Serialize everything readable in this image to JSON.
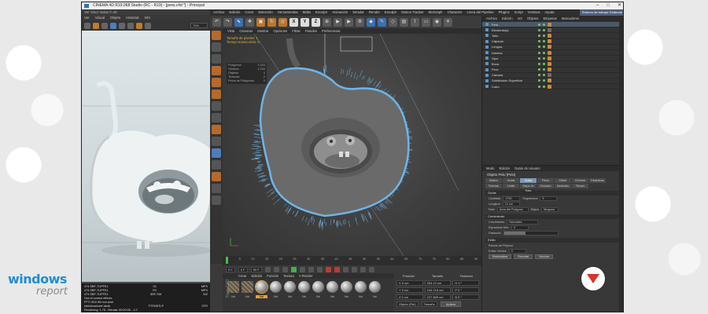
{
  "app": {
    "title": "CINEMA 4D R19.068 Studio (RC - R19) - [pera.c4d *] - Principal",
    "layout_label": "Entorno de trabajo: Estándar"
  },
  "viewer": {
    "title": "Ver Visor Variar F-40",
    "menu": [
      "Ver",
      "Visual",
      "Objeto",
      "Historial",
      "Info"
    ],
    "zoom": "70%",
    "stats": [
      {
        "k": "474 SBF-TUPFE1",
        "v": "S1",
        "v2": "MPS"
      },
      {
        "k": "474 SBF-TUPFE1",
        "v": "R1",
        "v2": "MPS"
      },
      {
        "k": "474 SBF-TUPFE1",
        "v": "SBF-SM",
        "v2": "W2"
      },
      {
        "k": "Out-of-control effects",
        "v": "",
        "v2": ""
      },
      {
        "k": "FFTI 5S2-98 rect.arsh",
        "v": "",
        "v2": ""
      },
      {
        "k": "Inbk4eas4wef-abnb",
        "v": "FTRXBTLP",
        "v2": "STR"
      },
      {
        "k": "Rendering: 1.75 - Mxrata: 00:00:06 - 1.2",
        "v": "",
        "v2": ""
      }
    ]
  },
  "menubar": [
    "Archivo",
    "Edición",
    "Crear",
    "Selección",
    "Herramientas",
    "Malla",
    "Esculpir",
    "Animación",
    "Simular",
    "Render",
    "Esculpir",
    "Motion Tracker",
    "MoGraph",
    "Character",
    "Línea del Pipeline",
    "Plugins",
    "Script",
    "Ventana",
    "Ayuda"
  ],
  "toolbar": {
    "axis_letters": [
      "X",
      "Y",
      "Z"
    ]
  },
  "viewport": {
    "menu": [
      "Vista",
      "Cámaras",
      "Mostrar",
      "Opciones",
      "Filtrar",
      "Paneles",
      "Preferencias"
    ],
    "hud_lines": [
      "Tamaño de píxeles: 1",
      "Tiempo transcurrido: 0"
    ],
    "info_rows": [
      {
        "k": "Polígonos",
        "v": "1.024"
      },
      {
        "k": "Vértices",
        "v": "1.240"
      },
      {
        "k": "Objetos",
        "v": "4"
      },
      {
        "k": "Texturas",
        "v": "2"
      },
      {
        "k": "Pelos de Polígonos",
        "v": "0"
      }
    ]
  },
  "timeline": {
    "marks": [
      "0",
      "5",
      "10",
      "15",
      "20",
      "25",
      "30",
      "35",
      "40",
      "45",
      "50",
      "55",
      "60",
      "65",
      "70",
      "75",
      "80",
      "85",
      "90"
    ],
    "frame_start": "0 F",
    "frame_end": "90 F",
    "current": "0 F"
  },
  "materials": {
    "menu": [
      "Crear",
      "Edición",
      "Función",
      "Textura",
      "A Render"
    ],
    "items": [
      "Mat",
      "Mat",
      "Mat",
      "Mat",
      "Mat",
      "Mat",
      "Mat",
      "Mat",
      "Mat",
      "Mat",
      "Mat"
    ],
    "selected_index": 2,
    "side_label": "Tipos C4D"
  },
  "coords": {
    "headers": [
      "Posición",
      "Tamaño",
      "Rotación"
    ],
    "rows": [
      [
        "X 0 cm",
        "254.12 cm",
        "H 0 °"
      ],
      [
        "Y 0 cm",
        "244.716 cm",
        "P 0 °"
      ],
      [
        "Z 0 cm",
        "227.809 cm",
        "B 0 °"
      ]
    ],
    "mode": "Objeto (Rel)",
    "size_mode": "Tamaño",
    "apply_label": "Aplicar"
  },
  "objects": {
    "menu": [
      "Archivo",
      "Edición",
      "Ver",
      "Objetos",
      "Etiquetas",
      "Marcadores"
    ],
    "items": [
      {
        "name": "Pelo",
        "sel": true,
        "tag": "o"
      },
      {
        "name": "Elemento(s)",
        "sel": false,
        "tag": ""
      },
      {
        "name": "Tallo",
        "sel": false,
        "tag": "o"
      },
      {
        "name": "Cápsula",
        "sel": false,
        "tag": "o"
      },
      {
        "name": "Lengua",
        "sel": false,
        "tag": "o"
      },
      {
        "name": "Dientes",
        "sel": false,
        "tag": "o"
      },
      {
        "name": "Ojos",
        "sel": false,
        "tag": "o"
      },
      {
        "name": "Boca",
        "sel": false,
        "tag": "o"
      },
      {
        "name": "Pera",
        "sel": false,
        "tag": "o"
      },
      {
        "name": "Cámara",
        "sel": false,
        "tag": ""
      },
      {
        "name": "Subdivisión Superficie",
        "sel": false,
        "tag": "o"
      },
      {
        "name": "Cubo",
        "sel": false,
        "tag": "o"
      }
    ]
  },
  "attributes": {
    "menu": [
      "Modo",
      "Edición",
      "Datos de Usuario"
    ],
    "title": "Objeto Pelo [Pelo]",
    "tabs": [
      "Básico",
      "Guías",
      "Guías",
      "Pelos",
      "Editar",
      "Generar",
      "Dinámicas",
      "Fuerzas",
      "Límite",
      "Mapa de Rata",
      "Oclusión",
      "Iluminado",
      "Tiempo"
    ],
    "active_tab": 2,
    "sections": [
      "Guías",
      "Crecimiento",
      "Estilo"
    ],
    "fields": [
      {
        "label": "Cantidad",
        "value": "1730"
      },
      {
        "label": "Segmentos",
        "value": "5"
      },
      {
        "label": "Longitud",
        "value": "12 cm"
      },
      {
        "label": "Raíz",
        "value": "Área del Polígono"
      },
      {
        "label": "Etapa",
        "value": "Ninguna"
      },
      {
        "label": "Crecimiento",
        "value": "Normales"
      },
      {
        "label": "Espaciado Mín.",
        "value": "0"
      },
      {
        "label": "Distancia",
        "value": ""
      },
      {
        "label": "Estado de Reposo",
        "value": ""
      },
      {
        "label": "Editar Vértice",
        "value": "0"
      }
    ],
    "buttons": [
      "Reinicializar",
      "Recortar",
      "Vincular"
    ]
  },
  "watermark": {
    "line1": "windows",
    "line2": "report"
  },
  "colors": {
    "accent": "#e4a23b",
    "selection": "#7c97b6",
    "fur": "#6fb4e8",
    "brand_blue": "#1c8fd6",
    "badge_red": "#d9332a"
  }
}
